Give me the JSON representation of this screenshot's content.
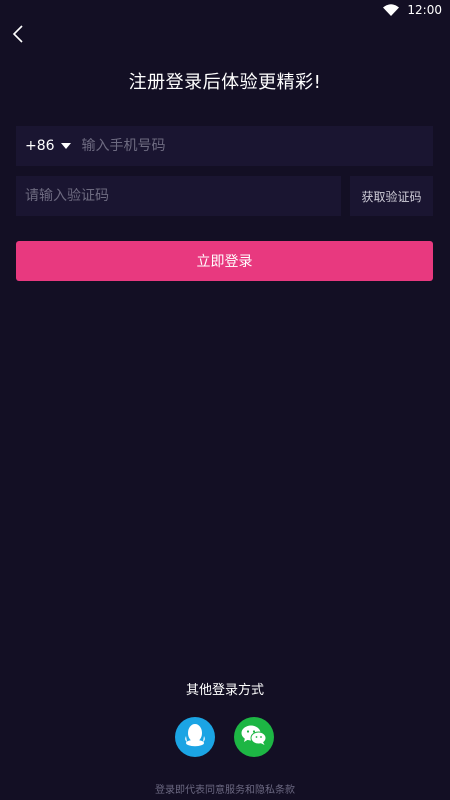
{
  "status_bar": {
    "time": "12:00"
  },
  "header": {
    "title": "注册登录后体验更精彩!"
  },
  "phone": {
    "country_code": "+86",
    "placeholder": "输入手机号码",
    "value": ""
  },
  "verification": {
    "placeholder": "请输入验证码",
    "value": "",
    "get_code_label": "获取验证码"
  },
  "login_button": {
    "label": "立即登录"
  },
  "other_login": {
    "label": "其他登录方式",
    "methods": [
      {
        "name": "QQ",
        "icon": "qq-icon",
        "color": "#1ba4e4"
      },
      {
        "name": "WeChat",
        "icon": "wechat-icon",
        "color": "#1db644"
      }
    ]
  },
  "agreement": {
    "text": "登录即代表同意服务和隐私条款"
  },
  "colors": {
    "background": "#130f24",
    "field": "#1a1531",
    "accent": "#e8397f"
  }
}
